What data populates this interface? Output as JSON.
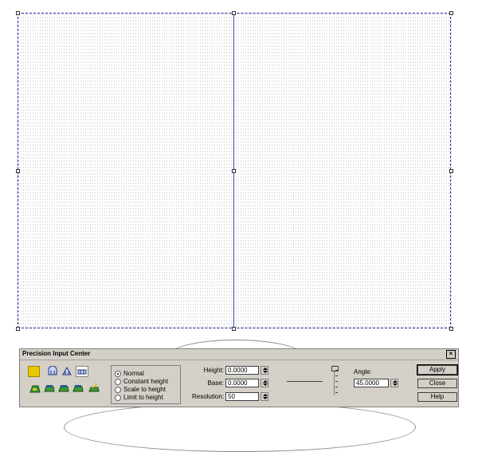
{
  "dialog": {
    "title": "Precision Input Center",
    "close_glyph": "×",
    "tools": [
      {
        "icon": "square-shape-icon"
      },
      {
        "icon": "arch-shape-icon"
      },
      {
        "icon": "gable-shape-icon"
      },
      {
        "icon": "rect-shape-icon"
      },
      {
        "icon": "extrude-green-icon-1"
      },
      {
        "icon": "extrude-green-icon-2"
      },
      {
        "icon": "extrude-green-icon-3"
      },
      {
        "icon": "extrude-green-icon-4"
      },
      {
        "icon": "extrude-green-icon-5"
      }
    ],
    "modes": [
      {
        "label": "Normal",
        "selected": true
      },
      {
        "label": "Constant height",
        "selected": false
      },
      {
        "label": "Scale to height",
        "selected": false
      },
      {
        "label": "Limit to height",
        "selected": false
      }
    ],
    "height_label": "Height:",
    "height_value": "0.0000",
    "base_label": "Base:",
    "base_value": "0.0000",
    "resolution_label": "Resolution:",
    "resolution_value": "50",
    "angle_label": "Angle:",
    "angle_value": "45.0000",
    "buttons": {
      "apply": "Apply",
      "close": "Close",
      "help": "Help"
    }
  },
  "colors": {
    "selection": "#1a2a9a",
    "dialog_bg": "#d4d0c8",
    "tool_accent": "#e8c800"
  }
}
